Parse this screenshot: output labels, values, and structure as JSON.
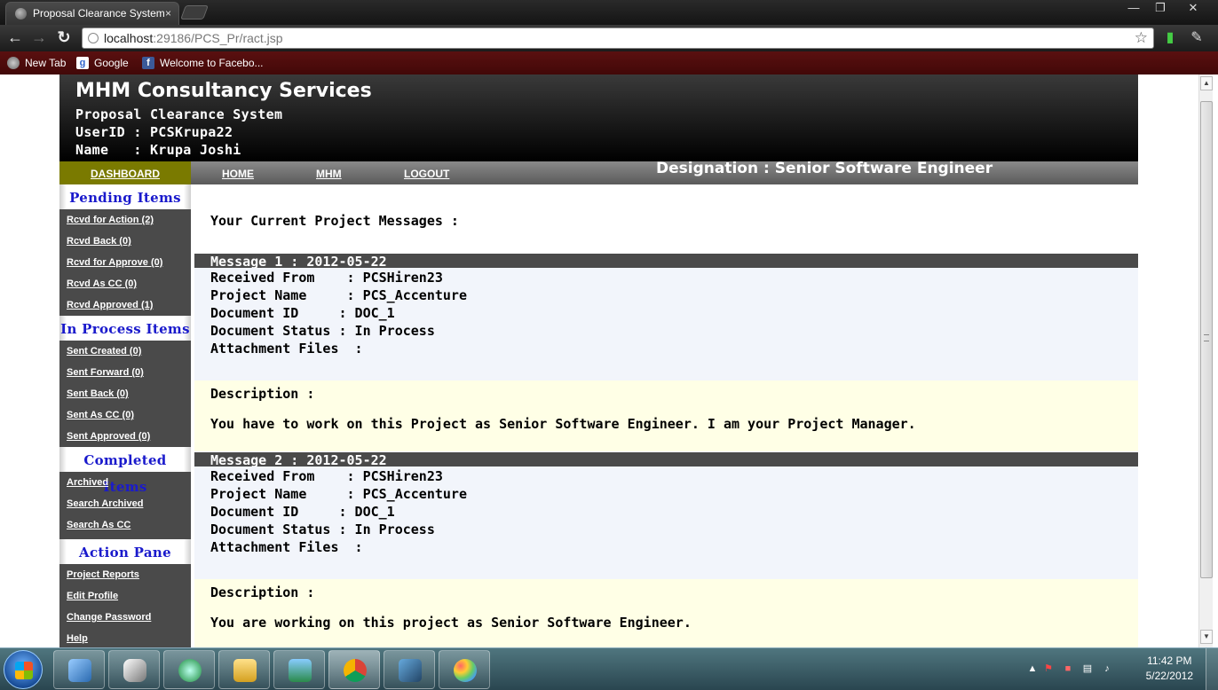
{
  "browser": {
    "tab_title": "Proposal Clearance System",
    "tab_close": "×",
    "url_host": "localhost",
    "url_rest": ":29186/PCS_Pr/ract.jsp",
    "bookmarks": [
      {
        "label": "New Tab"
      },
      {
        "label": "Google"
      },
      {
        "label": "Welcome to Facebo..."
      }
    ],
    "window_controls": {
      "minimize": "—",
      "maximize": "❐",
      "close": "✕"
    }
  },
  "header": {
    "company": "MHM Consultancy Services",
    "system": "Proposal Clearance System",
    "userid_line": "UserID : PCSKrupa22",
    "name_line": "Name   : Krupa Joshi"
  },
  "nav": {
    "dashboard": "DASHBOARD",
    "home": "HOME",
    "mhm": "MHM",
    "logout": "LOGOUT",
    "designation": "Designation : Senior Software Engineer"
  },
  "sidebar": {
    "sections": [
      {
        "title": "Pending Items",
        "items": [
          "Rcvd for Action (2)",
          "Rcvd Back (0)",
          "Rcvd for Approve (0)",
          "Rcvd As CC (0)",
          "Rcvd Approved (1)"
        ]
      },
      {
        "title": "In Process Items",
        "items": [
          "Sent Created (0)",
          "Sent Forward (0)",
          "Sent Back (0)",
          "Sent As CC (0)",
          "Sent Approved (0)"
        ]
      },
      {
        "title": "Completed Items",
        "items": [
          "Archived",
          "Search Archived",
          "Search As CC"
        ]
      },
      {
        "title": "Action Pane",
        "items": [
          "Project Reports",
          "Edit Profile",
          "Change Password",
          "Help"
        ]
      }
    ]
  },
  "content": {
    "heading": "Your Current Project Messages :",
    "messages": [
      {
        "header": "Message 1 : 2012-05-22",
        "received_from": "Received From    : PCSHiren23",
        "project_name": "Project Name     : PCS_Accenture",
        "document_id": "Document ID     : DOC_1",
        "document_status": "Document Status : In Process",
        "attachment": "Attachment Files  :",
        "description_label": "Description :",
        "description": "You have to work on this Project as Senior Software Engineer. I am your Project Manager."
      },
      {
        "header": "Message 2 : 2012-05-22",
        "received_from": "Received From    : PCSHiren23",
        "project_name": "Project Name     : PCS_Accenture",
        "document_id": "Document ID     : DOC_1",
        "document_status": "Document Status : In Process",
        "attachment": "Attachment Files  :",
        "description_label": "Description :",
        "description": "You are working on this project as Senior Software Engineer."
      }
    ]
  },
  "taskbar": {
    "time": "11:42 PM",
    "date": "5/22/2012"
  },
  "colors": {
    "accent_olive": "#7a7a00",
    "sidebar_bg": "#4a4a4a",
    "section_title": "#1a1acc",
    "info_bg": "#f2f5fb",
    "desc_bg": "#ffffe6"
  }
}
